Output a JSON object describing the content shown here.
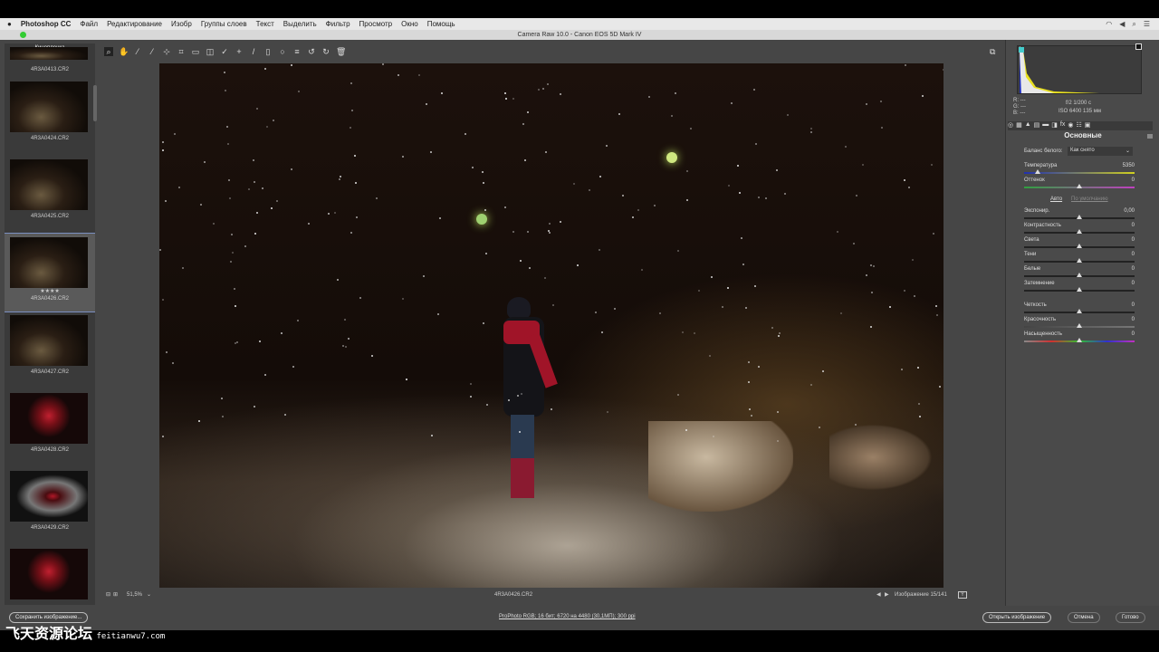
{
  "menubar": {
    "app": "Photoshop CC",
    "items": [
      "Файл",
      "Редактирование",
      "Изобр",
      "Группы слоев",
      "Текст",
      "Выделить",
      "Фильтр",
      "Просмотр",
      "Окно",
      "Помощь"
    ]
  },
  "window": {
    "title": "Camera Raw 10.0 - Canon EOS 5D Mark IV"
  },
  "filmstrip": {
    "header": "Кинопленка",
    "items": [
      {
        "name": "4R3A0413.CR2"
      },
      {
        "name": "4R3A0424.CR2"
      },
      {
        "name": "4R3A0425.CR2"
      },
      {
        "name": "4R3A0426.CR2",
        "stars": "★★★★",
        "selected": true
      },
      {
        "name": "4R3A0427.CR2"
      },
      {
        "name": "4R3A0428.CR2"
      },
      {
        "name": "4R3A0429.CR2"
      }
    ]
  },
  "readout": {
    "r": "R: ---",
    "g": "G: ---",
    "b": "B: ---",
    "exposure": "f/2   1/200 с",
    "iso": "ISO 6400   135 мм"
  },
  "panel": {
    "title": "Основные",
    "wb_label": "Баланс белого:",
    "wb_value": "Как снято",
    "auto": "Авто",
    "default": "По умолчанию",
    "sliders": [
      {
        "label": "Температура",
        "value": "5350",
        "pos": 0.12
      },
      {
        "label": "Оттенок",
        "value": "0",
        "pos": 0.5
      },
      {
        "label": "Экспонир.",
        "value": "0,00",
        "pos": 0.5
      },
      {
        "label": "Контрастность",
        "value": "0",
        "pos": 0.5
      },
      {
        "label": "Света",
        "value": "0",
        "pos": 0.5
      },
      {
        "label": "Тени",
        "value": "0",
        "pos": 0.5
      },
      {
        "label": "Белые",
        "value": "0",
        "pos": 0.5
      },
      {
        "label": "Затемнение",
        "value": "0",
        "pos": 0.5
      },
      {
        "label": "Четкость",
        "value": "0",
        "pos": 0.5
      },
      {
        "label": "Красочность",
        "value": "0",
        "pos": 0.5
      },
      {
        "label": "Насыщенность",
        "value": "0",
        "pos": 0.5
      }
    ]
  },
  "bottom": {
    "zoom": "51,5%",
    "filename": "4R3A0426.CR2",
    "nav": "Изображение 15/141",
    "save": "Сохранить изображение...",
    "workflow": "ProPhoto RGB; 16 бит; 6720 на 4480 (30,1МП); 300 ppi",
    "open": "Открыть изображение",
    "cancel": "Отмена",
    "done": "Готово"
  },
  "watermark": {
    "text": "飞天资源论坛",
    "url": "feitianwu7.com"
  }
}
